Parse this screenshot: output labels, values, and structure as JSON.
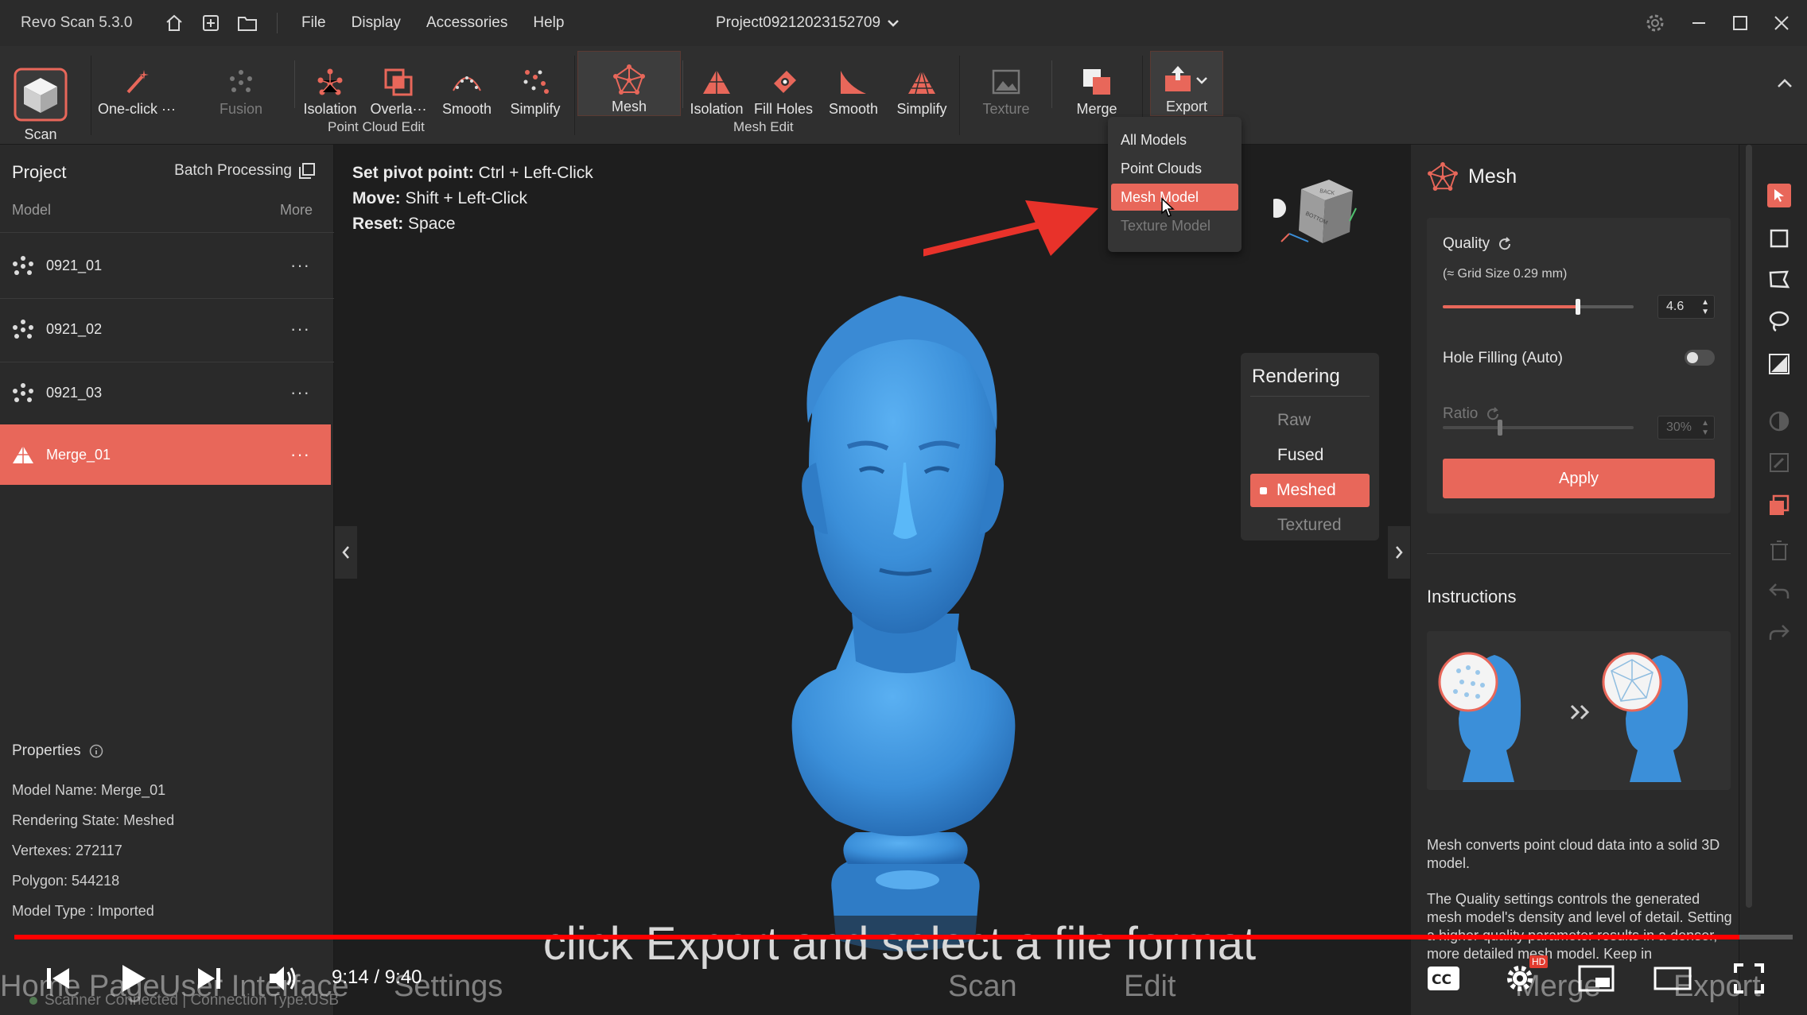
{
  "titlebar": {
    "app_title": "Revo Scan 5.3.0",
    "menu": [
      "File",
      "Display",
      "Accessories",
      "Help"
    ],
    "project_name": "Project09212023152709"
  },
  "toolbar": {
    "scan": "Scan",
    "one_click": "One-click ···",
    "fusion": "Fusion",
    "pc_isolation": "Isolation",
    "pc_overlap": "Overla···",
    "pc_smooth": "Smooth",
    "pc_simplify": "Simplify",
    "mesh": "Mesh",
    "me_isolation": "Isolation",
    "me_fill_holes": "Fill Holes",
    "me_smooth": "Smooth",
    "me_simplify": "Simplify",
    "texture": "Texture",
    "merge": "Merge",
    "export": "Export",
    "group_point_cloud": "Point Cloud Edit",
    "group_mesh": "Mesh Edit"
  },
  "left_panel": {
    "title": "Project",
    "batch_processing": "Batch Processing",
    "model_label": "Model",
    "more_label": "More",
    "models": [
      {
        "name": "0921_01",
        "selected": false
      },
      {
        "name": "0921_02",
        "selected": false
      },
      {
        "name": "0921_03",
        "selected": false
      },
      {
        "name": "Merge_01",
        "selected": true
      }
    ],
    "properties_title": "Properties",
    "properties": {
      "name": "Model Name:  Merge_01",
      "state": "Rendering State:  Meshed",
      "vertexes": "Vertexes:  272117",
      "polygon": "Polygon:  544218",
      "type": "Model Type :  Imported"
    }
  },
  "viewport": {
    "hints": [
      {
        "key": "Set pivot point:",
        "value": "Ctrl + Left-Click"
      },
      {
        "key": "Move:",
        "value": "Shift + Left-Click"
      },
      {
        "key": "Reset:",
        "value": "Space"
      }
    ],
    "rendering": {
      "title": "Rendering",
      "raw": "Raw",
      "fused": "Fused",
      "meshed": "Meshed",
      "textured": "Textured"
    },
    "export_menu": {
      "all_models": "All Models",
      "point_clouds": "Point Clouds",
      "mesh_model": "Mesh Model",
      "texture_model": "Texture Model"
    },
    "subtitle": "click Export and select a file format",
    "cube_faces": {
      "back": "BACK",
      "bottom": "BOTTOM"
    }
  },
  "right_panel": {
    "title": "Mesh",
    "quality_label": "Quality",
    "grid_size": "(≈ Grid Size 0.29 mm)",
    "quality_value": "4.6",
    "quality_fraction": 0.71,
    "hole_filling": "Hole Filling (Auto)",
    "ratio_label": "Ratio",
    "ratio_value": "30%",
    "ratio_fraction": 0.3,
    "apply": "Apply",
    "instructions_title": "Instructions",
    "instr_p1": "Mesh converts point cloud data into a solid 3D model.",
    "instr_p2": "The Quality settings controls the generated mesh model's density and level of detail. Setting a higher quality parameter results in a denser, more detailed mesh model. Keep in"
  },
  "video": {
    "time": "9:14 / 9:40",
    "progress_fraction": 0.97,
    "hd": "HD",
    "ghost_labels": {
      "home": "Home Page",
      "ui": "User Interface",
      "settings": "Settings",
      "scan": "Scan",
      "edit": "Edit",
      "merge": "Merge",
      "export": "Export"
    },
    "status": "Scanner Connected | Connection Type:USB"
  },
  "colors": {
    "accent": "#e8675a",
    "model_blue": "#3b8fd9",
    "bg": "#1e1e1e"
  }
}
